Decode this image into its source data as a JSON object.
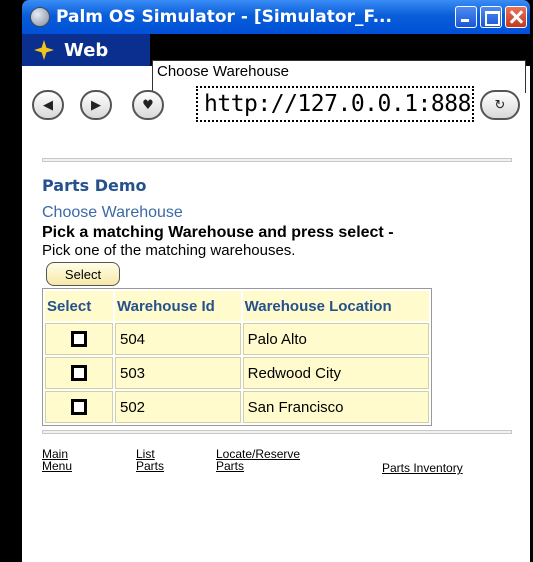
{
  "window": {
    "title": "Palm OS Simulator - [Simulator_F..."
  },
  "browser": {
    "app_label": "Web",
    "page_tab": "Choose Warehouse",
    "url": "http://127.0.0.1:888"
  },
  "page": {
    "heading": "Parts Demo",
    "subheading": "Choose Warehouse",
    "instruction": "Pick a matching Warehouse and press select -",
    "hint": "Pick one of the matching warehouses.",
    "select_label": "Select"
  },
  "table": {
    "headers": [
      "Select",
      "Warehouse Id",
      "Warehouse Location"
    ],
    "rows": [
      {
        "id": "504",
        "location": "Palo Alto"
      },
      {
        "id": "503",
        "location": "Redwood City"
      },
      {
        "id": "502",
        "location": "San Francisco"
      }
    ]
  },
  "footer": {
    "links": [
      {
        "line1": "Main",
        "line2": "Menu"
      },
      {
        "line1": "List",
        "line2": "Parts"
      },
      {
        "line1": "Locate/Reserve",
        "line2": "Parts"
      },
      {
        "line1": "Parts Inventory",
        "line2": ""
      }
    ]
  }
}
